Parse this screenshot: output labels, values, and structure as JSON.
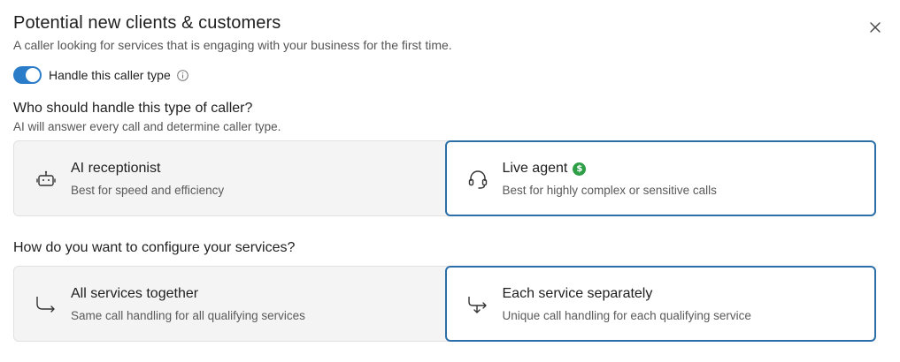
{
  "dialog": {
    "title": "Potential new clients & customers",
    "subtitle": "A caller looking for services that is engaging with your business for the first time."
  },
  "toggle": {
    "label": "Handle this caller type",
    "on": true,
    "accent": "#2a7bc8"
  },
  "handler_section": {
    "heading": "Who should handle this type of caller?",
    "subheading": "AI will answer every call and determine caller type.",
    "options": [
      {
        "title": "AI receptionist",
        "description": "Best for speed and efficiency",
        "icon": "robot-icon",
        "selected": false
      },
      {
        "title": "Live agent",
        "description": "Best for highly complex or sensitive calls",
        "icon": "headset-icon",
        "badge": "$",
        "selected": true
      }
    ]
  },
  "services_section": {
    "heading": "How do you want to configure your services?",
    "options": [
      {
        "title": "All services together",
        "description": "Same call handling for all qualifying services",
        "icon": "merge-arrow-icon",
        "selected": false
      },
      {
        "title": "Each service separately",
        "description": "Unique call handling for each qualifying service",
        "icon": "split-arrow-icon",
        "selected": true
      }
    ]
  },
  "colors": {
    "selected_border": "#2c6fa8",
    "badge_green": "#2e9e47"
  }
}
